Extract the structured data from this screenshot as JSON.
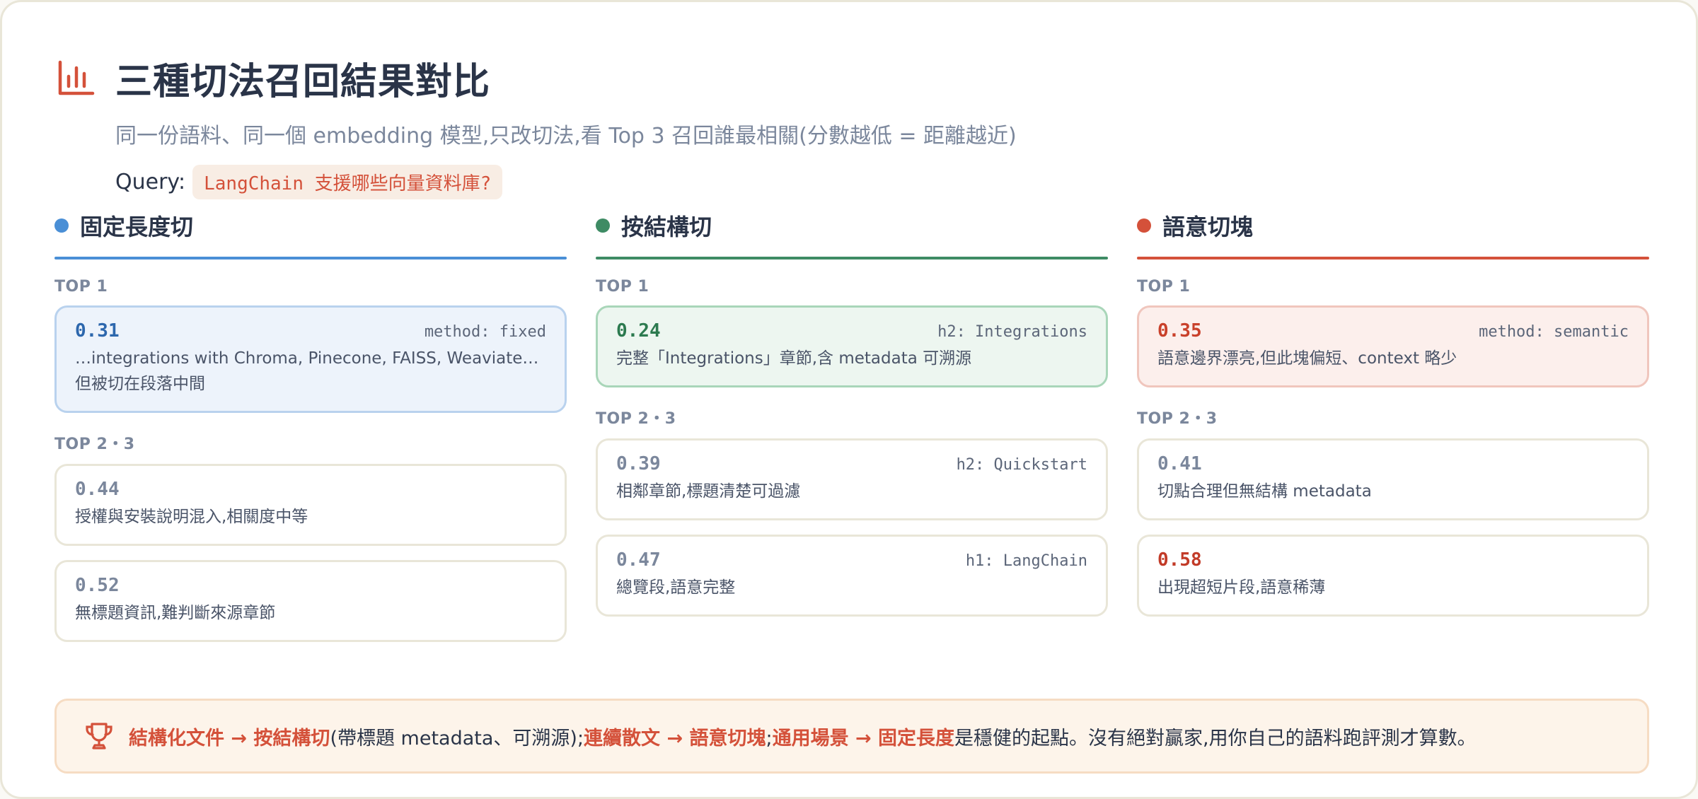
{
  "header": {
    "title": "三種切法召回結果對比",
    "subtitle": "同一份語料、同一個 embedding 模型,只改切法,看 Top 3 召回誰最相關(分數越低 = 距離越近)",
    "query_label": "Query:",
    "query_text": "LangChain 支援哪些向量資料庫?",
    "icon": "bar-chart-icon"
  },
  "columns": [
    {
      "title": "固定長度切",
      "color": "#4a8fd6",
      "top_label": "TOP 1",
      "rest_label": "TOP 2・3",
      "top": {
        "score": "0.31",
        "tag": "method: fixed",
        "desc": "…integrations with Chroma, Pinecone, FAISS, Weaviate… 但被切在段落中間"
      },
      "rest": [
        {
          "score": "0.44",
          "tag": "",
          "desc": "授權與安裝說明混入,相關度中等"
        },
        {
          "score": "0.52",
          "tag": "",
          "desc": "無標題資訊,難判斷來源章節"
        }
      ]
    },
    {
      "title": "按結構切",
      "color": "#3e8b64",
      "top_label": "TOP 1",
      "rest_label": "TOP 2・3",
      "top": {
        "score": "0.24",
        "tag": "h2: Integrations",
        "desc": "完整「Integrations」章節,含 metadata 可溯源"
      },
      "rest": [
        {
          "score": "0.39",
          "tag": "h2: Quickstart",
          "desc": "相鄰章節,標題清楚可過濾"
        },
        {
          "score": "0.47",
          "tag": "h1: LangChain",
          "desc": "總覽段,語意完整"
        }
      ]
    },
    {
      "title": "語意切塊",
      "color": "#d4513a",
      "top_label": "TOP 1",
      "rest_label": "TOP 2・3",
      "top": {
        "score": "0.35",
        "tag": "method: semantic",
        "desc": "語意邊界漂亮,但此塊偏短、context 略少"
      },
      "rest": [
        {
          "score": "0.41",
          "tag": "",
          "desc": "切點合理但無結構 metadata"
        },
        {
          "score": "0.58",
          "tag": "",
          "desc": "出現超短片段,語意稀薄"
        }
      ]
    }
  ],
  "footer": {
    "icon": "trophy-icon",
    "hl1": "結構化文件 → 按結構切",
    "t1": "(帶標題 metadata、可溯源);",
    "hl2": "連續散文 → 語意切塊",
    "t2": ";",
    "hl3": "通用場景 → 固定長度",
    "t3": "是穩健的起點。沒有絕對贏家,用你自己的語料跑評測才算數。"
  }
}
